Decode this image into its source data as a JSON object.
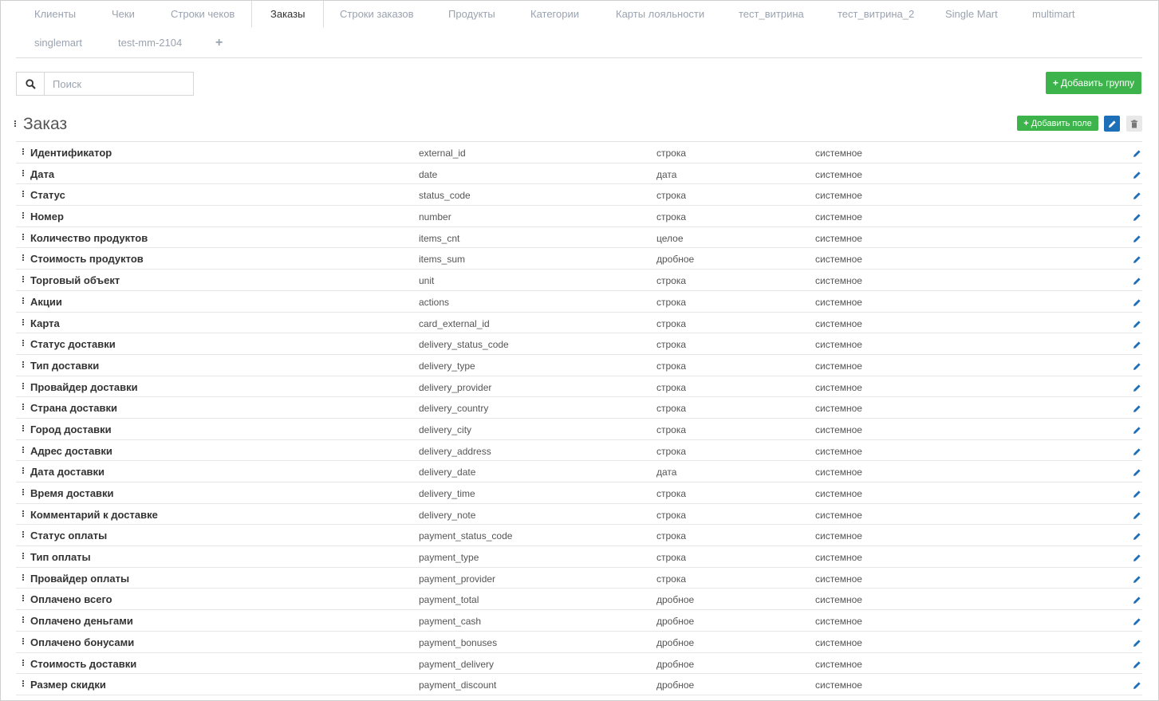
{
  "tabs": [
    {
      "label": "Клиенты",
      "active": false
    },
    {
      "label": "Чеки",
      "active": false
    },
    {
      "label": "Строки чеков",
      "active": false
    },
    {
      "label": "Заказы",
      "active": true
    },
    {
      "label": "Строки заказов",
      "active": false
    },
    {
      "label": "Продукты",
      "active": false
    },
    {
      "label": "Категории",
      "active": false
    },
    {
      "label": "Карты лояльности",
      "active": false
    },
    {
      "label": "тест_витрина",
      "active": false
    },
    {
      "label": "тест_витрина_2",
      "active": false
    },
    {
      "label": "Single Mart",
      "active": false
    },
    {
      "label": "multimart",
      "active": false
    },
    {
      "label": "singlemart",
      "active": false
    },
    {
      "label": "test-mm-2104",
      "active": false
    }
  ],
  "add_tab_icon": "plus-icon",
  "search": {
    "placeholder": "Поиск",
    "value": ""
  },
  "add_group_label": "Добавить группу",
  "group": {
    "title": "Заказ",
    "add_field_label": "Добавить поле",
    "fields": [
      {
        "label": "Идентификатор",
        "key": "external_id",
        "type": "строка",
        "kind": "системное"
      },
      {
        "label": "Дата",
        "key": "date",
        "type": "дата",
        "kind": "системное"
      },
      {
        "label": "Статус",
        "key": "status_code",
        "type": "строка",
        "kind": "системное"
      },
      {
        "label": "Номер",
        "key": "number",
        "type": "строка",
        "kind": "системное"
      },
      {
        "label": "Количество продуктов",
        "key": "items_cnt",
        "type": "целое",
        "kind": "системное"
      },
      {
        "label": "Стоимость продуктов",
        "key": "items_sum",
        "type": "дробное",
        "kind": "системное"
      },
      {
        "label": "Торговый объект",
        "key": "unit",
        "type": "строка",
        "kind": "системное"
      },
      {
        "label": "Акции",
        "key": "actions",
        "type": "строка",
        "kind": "системное"
      },
      {
        "label": "Карта",
        "key": "card_external_id",
        "type": "строка",
        "kind": "системное"
      },
      {
        "label": "Статус доставки",
        "key": "delivery_status_code",
        "type": "строка",
        "kind": "системное"
      },
      {
        "label": "Тип доставки",
        "key": "delivery_type",
        "type": "строка",
        "kind": "системное"
      },
      {
        "label": "Провайдер доставки",
        "key": "delivery_provider",
        "type": "строка",
        "kind": "системное"
      },
      {
        "label": "Страна доставки",
        "key": "delivery_country",
        "type": "строка",
        "kind": "системное"
      },
      {
        "label": "Город доставки",
        "key": "delivery_city",
        "type": "строка",
        "kind": "системное"
      },
      {
        "label": "Адрес доставки",
        "key": "delivery_address",
        "type": "строка",
        "kind": "системное"
      },
      {
        "label": "Дата доставки",
        "key": "delivery_date",
        "type": "дата",
        "kind": "системное"
      },
      {
        "label": "Время доставки",
        "key": "delivery_time",
        "type": "строка",
        "kind": "системное"
      },
      {
        "label": "Комментарий к доставке",
        "key": "delivery_note",
        "type": "строка",
        "kind": "системное"
      },
      {
        "label": "Статус оплаты",
        "key": "payment_status_code",
        "type": "строка",
        "kind": "системное"
      },
      {
        "label": "Тип оплаты",
        "key": "payment_type",
        "type": "строка",
        "kind": "системное"
      },
      {
        "label": "Провайдер оплаты",
        "key": "payment_provider",
        "type": "строка",
        "kind": "системное"
      },
      {
        "label": "Оплачено всего",
        "key": "payment_total",
        "type": "дробное",
        "kind": "системное"
      },
      {
        "label": "Оплачено деньгами",
        "key": "payment_cash",
        "type": "дробное",
        "kind": "системное"
      },
      {
        "label": "Оплачено бонусами",
        "key": "payment_bonuses",
        "type": "дробное",
        "kind": "системное"
      },
      {
        "label": "Стоимость доставки",
        "key": "payment_delivery",
        "type": "дробное",
        "kind": "системное"
      },
      {
        "label": "Размер скидки",
        "key": "payment_discount",
        "type": "дробное",
        "kind": "системное"
      }
    ]
  },
  "colors": {
    "accent_green": "#3cb44b",
    "accent_blue": "#1d6fb8",
    "muted_text": "#9aa3b0"
  }
}
